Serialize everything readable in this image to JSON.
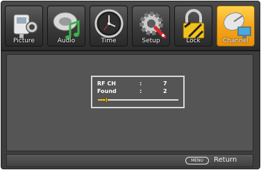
{
  "menu": {
    "tabs": [
      {
        "label": "Picture",
        "icon": "camera-icon",
        "active": false
      },
      {
        "label": "Audio",
        "icon": "music-note-icon",
        "active": false
      },
      {
        "label": "Time",
        "icon": "clock-icon",
        "active": false
      },
      {
        "label": "Setup",
        "icon": "gear-wrench-icon",
        "active": false
      },
      {
        "label": "Lock",
        "icon": "padlock-icon",
        "active": false
      },
      {
        "label": "Channel",
        "icon": "satellite-dish-icon",
        "active": true
      }
    ]
  },
  "scan": {
    "rf_ch_label": "RF CH",
    "rf_ch_sep": ":",
    "rf_ch_value": "7",
    "found_label": "Found",
    "found_sep": ":",
    "found_value": "2",
    "progress": 0.1
  },
  "footer": {
    "menu_key": "MENU",
    "return_label": "Return"
  },
  "colors": {
    "accent": "#f7a71c",
    "background": "#3d3d3d",
    "progress": "#f4c21d"
  }
}
